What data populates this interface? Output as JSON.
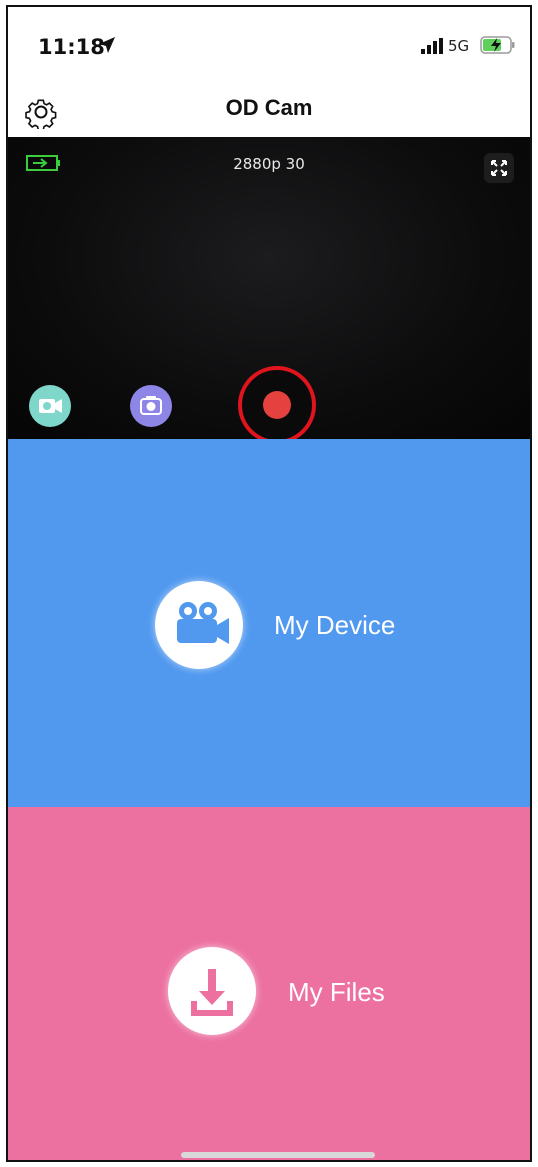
{
  "status_bar": {
    "time": "11:18",
    "network": "5G",
    "icons": [
      "location-arrow-icon",
      "signal-bars-icon",
      "battery-charging-icon"
    ]
  },
  "nav": {
    "title": "OD Cam",
    "settings_icon": "gear-icon"
  },
  "preview": {
    "resolution": "2880p 30",
    "icons": [
      "camera-battery-icon",
      "fullscreen-icon",
      "video-camera-icon",
      "photo-camera-icon",
      "record-icon"
    ],
    "colors": {
      "record_ring": "#e0141d",
      "record_dot": "#e4413f",
      "video_mode": "#7fd7cc",
      "photo_mode": "#8e86e6"
    }
  },
  "tiles": {
    "device": {
      "label": "My Device",
      "icon": "movie-camera-icon",
      "color": "#5099ef"
    },
    "files": {
      "label": "My Files",
      "icon": "download-icon",
      "color": "#ec70a0"
    }
  }
}
